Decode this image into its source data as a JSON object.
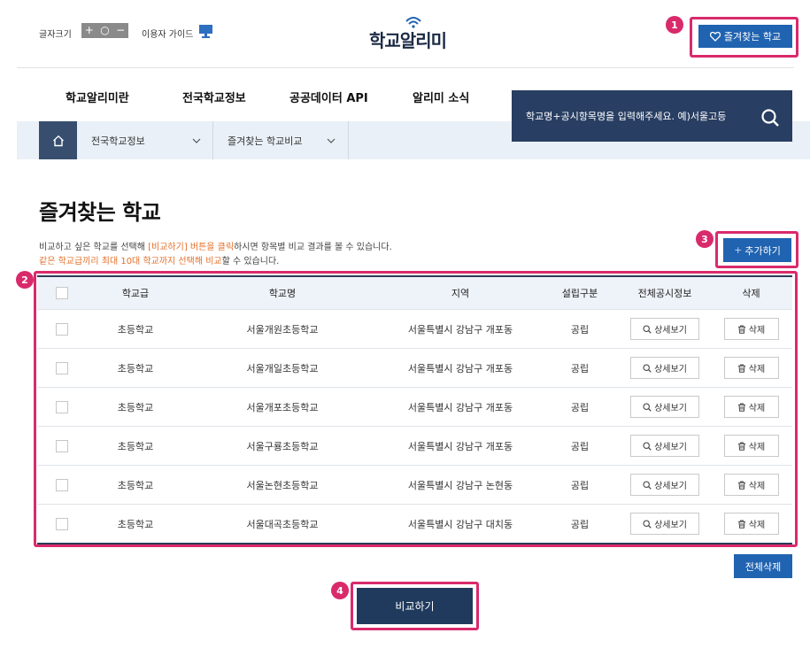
{
  "header": {
    "font_size_label": "글자크기",
    "font_size_controls": [
      "+",
      "○",
      "−"
    ],
    "guide_label": "이용자 가이드",
    "logo_text": "학교알리미",
    "favorite_button": "즐겨찾는 학교"
  },
  "nav": {
    "items": [
      "학교알리미란",
      "전국학교정보",
      "공공데이터 API",
      "알리미 소식"
    ]
  },
  "search": {
    "placeholder": "학교명+공시항목명을 입력해주세요. 예)서울고등"
  },
  "breadcrumb": {
    "items": [
      "전국학교정보",
      "즐겨찾는 학교비교"
    ]
  },
  "page": {
    "title": "즐겨찾는 학교",
    "desc1_a": "비교하고 싶은 학교를 선택해 ",
    "desc1_b": "[비교하기] 버튼을 클릭",
    "desc1_c": "하시면 항목별 비교 결과를 볼 수 있습니다.",
    "desc2_a": "같은 학교급끼리 최대 10대 학교까지 선택해 비교",
    "desc2_b": "할 수 있습니다.",
    "add_button": "추가하기",
    "add_symbol": "+"
  },
  "table": {
    "headers": [
      "학교급",
      "학교명",
      "지역",
      "설립구분",
      "전체공시정보",
      "삭제"
    ],
    "rows": [
      {
        "level": "초등학교",
        "name": "서울개원초등학교",
        "region": "서울특별시 강남구 개포동",
        "type": "공립"
      },
      {
        "level": "초등학교",
        "name": "서울개일초등학교",
        "region": "서울특별시 강남구 개포동",
        "type": "공립"
      },
      {
        "level": "초등학교",
        "name": "서울개포초등학교",
        "region": "서울특별시 강남구 개포동",
        "type": "공립"
      },
      {
        "level": "초등학교",
        "name": "서울구룡초등학교",
        "region": "서울특별시 강남구 개포동",
        "type": "공립"
      },
      {
        "level": "초등학교",
        "name": "서울논현초등학교",
        "region": "서울특별시 강남구 논현동",
        "type": "공립"
      },
      {
        "level": "초등학교",
        "name": "서울대곡초등학교",
        "region": "서울특별시 강남구 대치동",
        "type": "공립"
      }
    ],
    "detail_label": "상세보기",
    "delete_label": "삭제"
  },
  "actions": {
    "delete_all": "전체삭제",
    "compare": "비교하기"
  },
  "annotations": [
    "1",
    "2",
    "3",
    "4"
  ],
  "colors": {
    "primary_blue": "#2063b0",
    "dark_navy": "#283e62",
    "highlight": "#d92a6b",
    "accent_orange": "#e3702b"
  }
}
